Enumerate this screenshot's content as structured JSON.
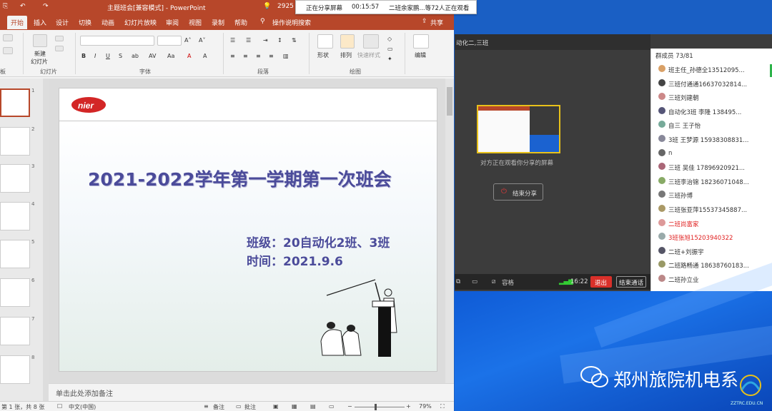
{
  "ppt": {
    "title": "主题班会[兼容模式] - PowerPoint",
    "ribbon_tabs": [
      "开始",
      "插入",
      "设计",
      "切换",
      "动画",
      "幻灯片放映",
      "审阅",
      "视图",
      "录制",
      "帮助"
    ],
    "tell_me": "操作说明搜索",
    "share": "共享",
    "new_slide_line1": "新建",
    "new_slide_line2": "幻灯片",
    "groups": [
      "板",
      "幻灯片",
      "字体",
      "段落",
      "绘图",
      "编辑"
    ],
    "draw_items": [
      "形状",
      "排列",
      "快速样式"
    ],
    "edit_label": "编辑",
    "slide_title": "2021-2022学年第一学期第一次班会",
    "slide_class": "班级：20自动化2班、3班",
    "slide_time": "时间：2021.9.6",
    "logo_text": "nier",
    "notes_placeholder": "单击此处添加备注",
    "status": {
      "slide": "第 1 张，共 8 张",
      "lang": "中文(中国)",
      "notes": "备注",
      "comments": "批注",
      "zoom": "79%"
    },
    "thumb_numbers": [
      "1",
      "2",
      "3",
      "4",
      "5",
      "6",
      "7",
      "8"
    ],
    "partial_number": "2925"
  },
  "sharebar": {
    "status": "正在分享屏幕",
    "timer": "00:15:57",
    "viewers": "二班余家鹏...等72人正在观看"
  },
  "meeting": {
    "title": "动化二,三班",
    "watching": "对方正在观看你分享的屏幕",
    "end_share": "结束分享",
    "bottom_time": "16:22",
    "bottom_label": "容格",
    "exit": "退出",
    "end_call": "结束通话",
    "members_header": "群成员 73/81",
    "members": [
      {
        "name": "班主任_孙德全13512095...",
        "color": "#333"
      },
      {
        "name": "三班付通通16637032814...",
        "color": "#333"
      },
      {
        "name": "三班刘建朝",
        "color": "#333"
      },
      {
        "name": "自动化3班  李隆 138495...",
        "color": "#333"
      },
      {
        "name": "自三 王子怡",
        "color": "#333"
      },
      {
        "name": "3班 王梦源 15938308831...",
        "color": "#333"
      },
      {
        "name": "n",
        "color": "#333"
      },
      {
        "name": "三班 吴佳 17896920921...",
        "color": "#333"
      },
      {
        "name": "三班李治锦 18236071048...",
        "color": "#333"
      },
      {
        "name": "三班孙博",
        "color": "#333"
      },
      {
        "name": "三班张亚萍15537345887...",
        "color": "#333"
      },
      {
        "name": "二班尚富家",
        "color": "#e02020"
      },
      {
        "name": "3班张旭15203940322",
        "color": "#e02020"
      },
      {
        "name": "二班+刘振宇",
        "color": "#333"
      },
      {
        "name": "二班路畅通 18638760183...",
        "color": "#333"
      },
      {
        "name": "二班孙立业",
        "color": "#333"
      }
    ]
  },
  "watermark": {
    "text": "郑州旅院机电系",
    "url": "ZZTRC.EDU.CN"
  },
  "colors": {
    "ppt_accent": "#b7472a",
    "slide_text": "#4b4b9a",
    "exit_red": "#d9302a"
  }
}
